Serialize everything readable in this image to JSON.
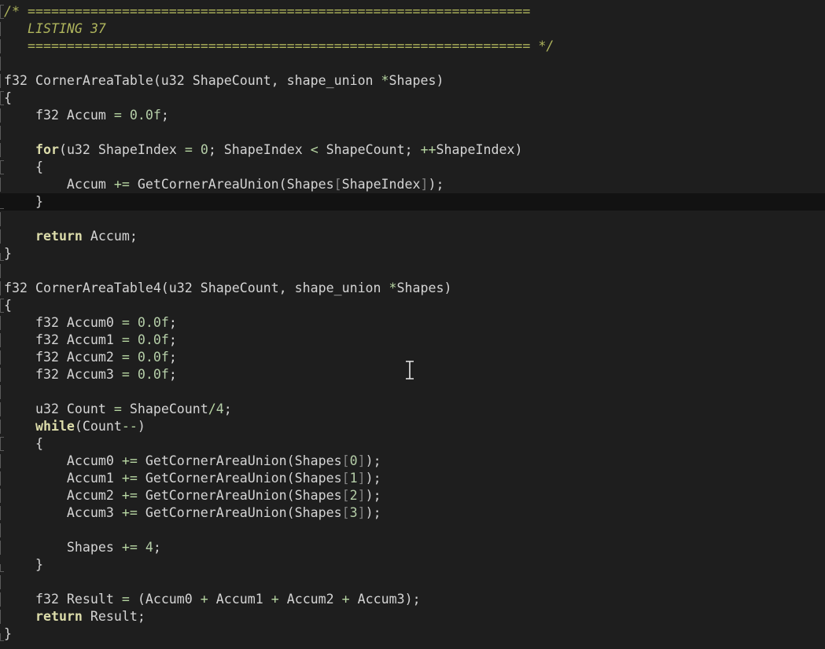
{
  "editor": {
    "cursor": "i-beam-cursor",
    "current_line": 11,
    "colors": {
      "background": "#1e1e1e",
      "current_line": "#121212",
      "text": "#d4d4d4",
      "comment": "#aeb45c",
      "keyword": "#dcdcaa",
      "number": "#b5cea8",
      "operator": "#b8d7a3"
    },
    "lines": [
      {
        "gutter": "open",
        "tokens": [
          {
            "t": "cm",
            "v": "/* ================================================================"
          }
        ]
      },
      {
        "gutter": "",
        "tokens": [
          {
            "t": "cm",
            "v": "   LISTING 37"
          }
        ]
      },
      {
        "gutter": "",
        "tokens": [
          {
            "t": "cm",
            "v": "   ================================================================ */"
          }
        ]
      },
      {
        "gutter": "",
        "tokens": []
      },
      {
        "gutter": "",
        "tokens": [
          {
            "t": "def",
            "v": "f32 CornerAreaTable(u32 ShapeCount, shape_union "
          },
          {
            "t": "op",
            "v": "*"
          },
          {
            "t": "def",
            "v": "Shapes)"
          }
        ]
      },
      {
        "gutter": "open",
        "tokens": [
          {
            "t": "def",
            "v": "{"
          }
        ]
      },
      {
        "gutter": "",
        "tokens": [
          {
            "t": "def",
            "v": "    f32 Accum "
          },
          {
            "t": "op",
            "v": "="
          },
          {
            "t": "def",
            "v": " "
          },
          {
            "t": "num",
            "v": "0.0f"
          },
          {
            "t": "def",
            "v": ";"
          }
        ]
      },
      {
        "gutter": "",
        "tokens": []
      },
      {
        "gutter": "",
        "tokens": [
          {
            "t": "def",
            "v": "    "
          },
          {
            "t": "kwb",
            "v": "for"
          },
          {
            "t": "def",
            "v": "(u32 ShapeIndex "
          },
          {
            "t": "op",
            "v": "="
          },
          {
            "t": "def",
            "v": " "
          },
          {
            "t": "num",
            "v": "0"
          },
          {
            "t": "def",
            "v": "; ShapeIndex "
          },
          {
            "t": "op",
            "v": "<"
          },
          {
            "t": "def",
            "v": " ShapeCount; "
          },
          {
            "t": "op",
            "v": "++"
          },
          {
            "t": "def",
            "v": "ShapeIndex)"
          }
        ]
      },
      {
        "gutter": "open",
        "tokens": [
          {
            "t": "def",
            "v": "    {"
          }
        ]
      },
      {
        "gutter": "",
        "tokens": [
          {
            "t": "def",
            "v": "        Accum "
          },
          {
            "t": "op",
            "v": "+="
          },
          {
            "t": "def",
            "v": " GetCornerAreaUnion(Shapes"
          },
          {
            "t": "brk",
            "v": "["
          },
          {
            "t": "def",
            "v": "ShapeIndex"
          },
          {
            "t": "brk",
            "v": "]"
          },
          {
            "t": "def",
            "v": ");"
          }
        ]
      },
      {
        "gutter": "mid",
        "tokens": [
          {
            "t": "def",
            "v": "    }"
          }
        ]
      },
      {
        "gutter": "",
        "tokens": []
      },
      {
        "gutter": "",
        "tokens": [
          {
            "t": "def",
            "v": "    "
          },
          {
            "t": "kwb",
            "v": "return"
          },
          {
            "t": "def",
            "v": " Accum;"
          }
        ]
      },
      {
        "gutter": "close",
        "tokens": [
          {
            "t": "def",
            "v": "}"
          }
        ]
      },
      {
        "gutter": "",
        "tokens": []
      },
      {
        "gutter": "",
        "tokens": [
          {
            "t": "def",
            "v": "f32 CornerAreaTable4(u32 ShapeCount, shape_union "
          },
          {
            "t": "op",
            "v": "*"
          },
          {
            "t": "def",
            "v": "Shapes)"
          }
        ]
      },
      {
        "gutter": "open",
        "tokens": [
          {
            "t": "def",
            "v": "{"
          }
        ]
      },
      {
        "gutter": "",
        "tokens": [
          {
            "t": "def",
            "v": "    f32 Accum0 "
          },
          {
            "t": "op",
            "v": "="
          },
          {
            "t": "def",
            "v": " "
          },
          {
            "t": "num",
            "v": "0.0f"
          },
          {
            "t": "def",
            "v": ";"
          }
        ]
      },
      {
        "gutter": "",
        "tokens": [
          {
            "t": "def",
            "v": "    f32 Accum1 "
          },
          {
            "t": "op",
            "v": "="
          },
          {
            "t": "def",
            "v": " "
          },
          {
            "t": "num",
            "v": "0.0f"
          },
          {
            "t": "def",
            "v": ";"
          }
        ]
      },
      {
        "gutter": "",
        "tokens": [
          {
            "t": "def",
            "v": "    f32 Accum2 "
          },
          {
            "t": "op",
            "v": "="
          },
          {
            "t": "def",
            "v": " "
          },
          {
            "t": "num",
            "v": "0.0f"
          },
          {
            "t": "def",
            "v": ";"
          }
        ]
      },
      {
        "gutter": "",
        "tokens": [
          {
            "t": "def",
            "v": "    f32 Accum3 "
          },
          {
            "t": "op",
            "v": "="
          },
          {
            "t": "def",
            "v": " "
          },
          {
            "t": "num",
            "v": "0.0f"
          },
          {
            "t": "def",
            "v": ";"
          }
        ]
      },
      {
        "gutter": "",
        "tokens": []
      },
      {
        "gutter": "",
        "tokens": [
          {
            "t": "def",
            "v": "    u32 Count "
          },
          {
            "t": "op",
            "v": "="
          },
          {
            "t": "def",
            "v": " ShapeCount"
          },
          {
            "t": "op",
            "v": "/"
          },
          {
            "t": "num",
            "v": "4"
          },
          {
            "t": "def",
            "v": ";"
          }
        ]
      },
      {
        "gutter": "",
        "tokens": [
          {
            "t": "def",
            "v": "    "
          },
          {
            "t": "kwb",
            "v": "while"
          },
          {
            "t": "def",
            "v": "(Count"
          },
          {
            "t": "op",
            "v": "--"
          },
          {
            "t": "def",
            "v": ")"
          }
        ]
      },
      {
        "gutter": "open",
        "tokens": [
          {
            "t": "def",
            "v": "    {"
          }
        ]
      },
      {
        "gutter": "",
        "tokens": [
          {
            "t": "def",
            "v": "        Accum0 "
          },
          {
            "t": "op",
            "v": "+="
          },
          {
            "t": "def",
            "v": " GetCornerAreaUnion(Shapes"
          },
          {
            "t": "brk",
            "v": "["
          },
          {
            "t": "num",
            "v": "0"
          },
          {
            "t": "brk",
            "v": "]"
          },
          {
            "t": "def",
            "v": ");"
          }
        ]
      },
      {
        "gutter": "",
        "tokens": [
          {
            "t": "def",
            "v": "        Accum1 "
          },
          {
            "t": "op",
            "v": "+="
          },
          {
            "t": "def",
            "v": " GetCornerAreaUnion(Shapes"
          },
          {
            "t": "brk",
            "v": "["
          },
          {
            "t": "num",
            "v": "1"
          },
          {
            "t": "brk",
            "v": "]"
          },
          {
            "t": "def",
            "v": ");"
          }
        ]
      },
      {
        "gutter": "",
        "tokens": [
          {
            "t": "def",
            "v": "        Accum2 "
          },
          {
            "t": "op",
            "v": "+="
          },
          {
            "t": "def",
            "v": " GetCornerAreaUnion(Shapes"
          },
          {
            "t": "brk",
            "v": "["
          },
          {
            "t": "num",
            "v": "2"
          },
          {
            "t": "brk",
            "v": "]"
          },
          {
            "t": "def",
            "v": ");"
          }
        ]
      },
      {
        "gutter": "",
        "tokens": [
          {
            "t": "def",
            "v": "        Accum3 "
          },
          {
            "t": "op",
            "v": "+="
          },
          {
            "t": "def",
            "v": " GetCornerAreaUnion(Shapes"
          },
          {
            "t": "brk",
            "v": "["
          },
          {
            "t": "num",
            "v": "3"
          },
          {
            "t": "brk",
            "v": "]"
          },
          {
            "t": "def",
            "v": ");"
          }
        ]
      },
      {
        "gutter": "",
        "tokens": []
      },
      {
        "gutter": "",
        "tokens": [
          {
            "t": "def",
            "v": "        Shapes "
          },
          {
            "t": "op",
            "v": "+="
          },
          {
            "t": "def",
            "v": " "
          },
          {
            "t": "num",
            "v": "4"
          },
          {
            "t": "def",
            "v": ";"
          }
        ]
      },
      {
        "gutter": "close",
        "tokens": [
          {
            "t": "def",
            "v": "    }"
          }
        ]
      },
      {
        "gutter": "",
        "tokens": []
      },
      {
        "gutter": "",
        "tokens": [
          {
            "t": "def",
            "v": "    f32 Result "
          },
          {
            "t": "op",
            "v": "="
          },
          {
            "t": "def",
            "v": " (Accum0 "
          },
          {
            "t": "op",
            "v": "+"
          },
          {
            "t": "def",
            "v": " Accum1 "
          },
          {
            "t": "op",
            "v": "+"
          },
          {
            "t": "def",
            "v": " Accum2 "
          },
          {
            "t": "op",
            "v": "+"
          },
          {
            "t": "def",
            "v": " Accum3);"
          }
        ]
      },
      {
        "gutter": "",
        "tokens": [
          {
            "t": "def",
            "v": "    "
          },
          {
            "t": "kwb",
            "v": "return"
          },
          {
            "t": "def",
            "v": " Result;"
          }
        ]
      },
      {
        "gutter": "close",
        "tokens": [
          {
            "t": "def",
            "v": "}"
          }
        ]
      }
    ]
  }
}
